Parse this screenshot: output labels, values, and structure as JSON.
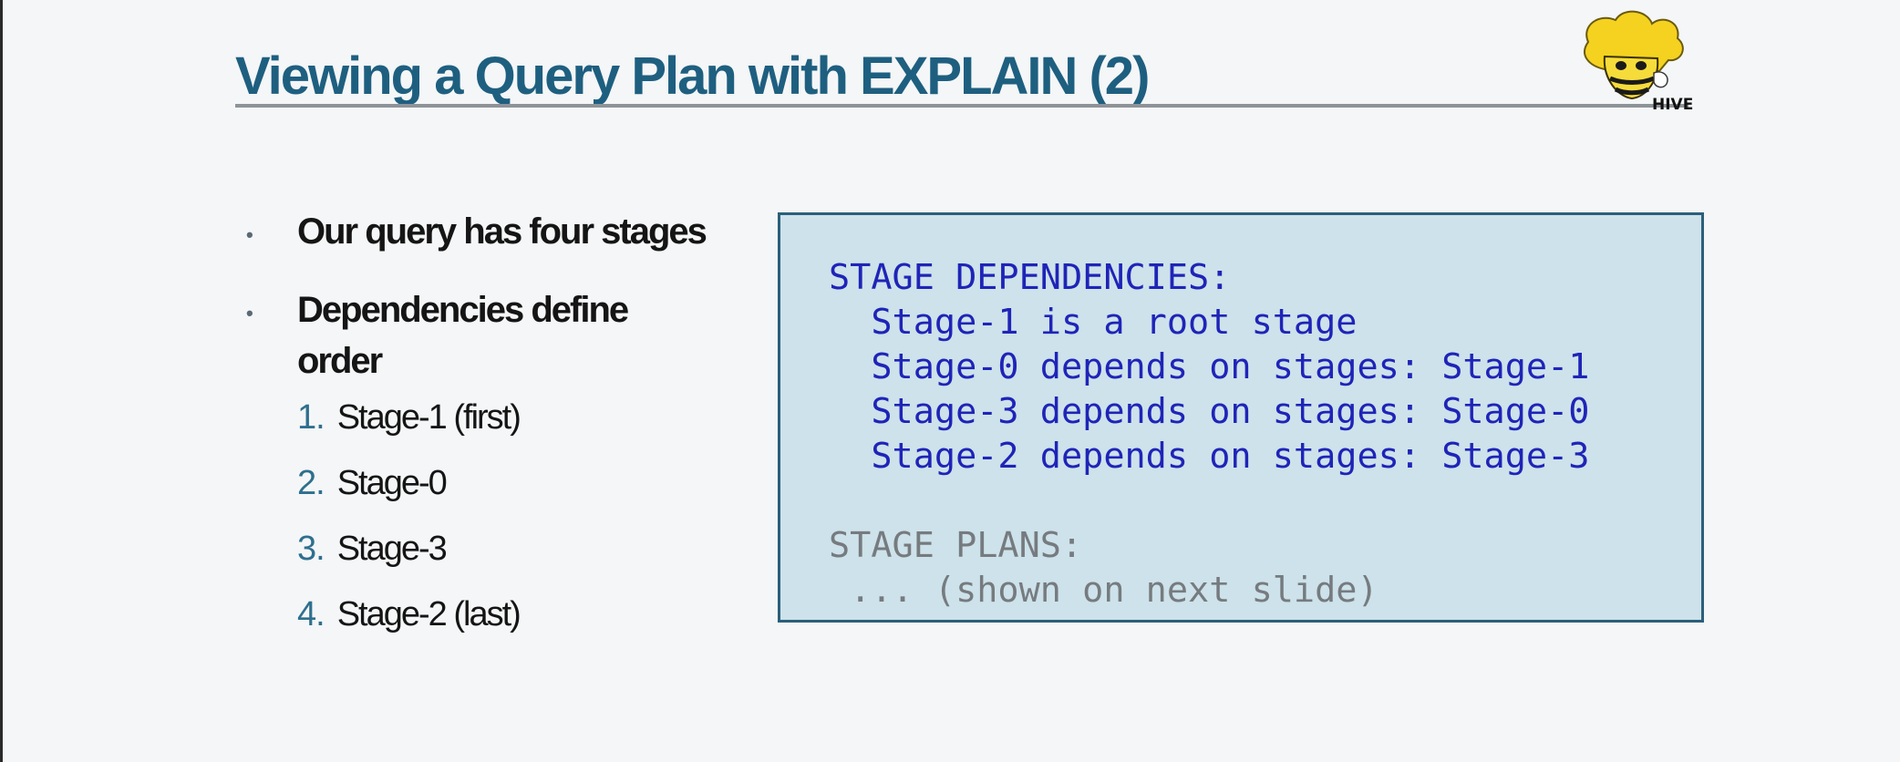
{
  "slide": {
    "title": "Viewing a Query Plan with EXPLAIN (2)",
    "logo": {
      "icon": "hive-bee-icon",
      "text": "HIVE"
    },
    "bullets": [
      {
        "text": "Our query has four stages"
      },
      {
        "text": "Dependencies define order"
      }
    ],
    "steps": [
      {
        "number": "1.",
        "label": "Stage-1 (first)"
      },
      {
        "number": "2.",
        "label": "Stage-0"
      },
      {
        "number": "3.",
        "label": "Stage-3"
      },
      {
        "number": "4.",
        "label": "Stage-2 (last)"
      }
    ],
    "code": {
      "dependencies_header": "STAGE DEPENDENCIES:",
      "dependency_lines": [
        "  Stage-1 is a root stage",
        "  Stage-0 depends on stages: Stage-1",
        "  Stage-3 depends on stages: Stage-0",
        "  Stage-2 depends on stages: Stage-3"
      ],
      "plans_header": "STAGE PLANS:",
      "plans_note": " ... (shown on next slide)"
    }
  },
  "colors": {
    "title": "#1e5f80",
    "code_box_bg": "#cde2ea",
    "code_box_border": "#2b5f7a",
    "code_dependency_text": "#1f24b8",
    "code_plans_text": "#767b7f",
    "step_number": "#2f6f8e"
  }
}
